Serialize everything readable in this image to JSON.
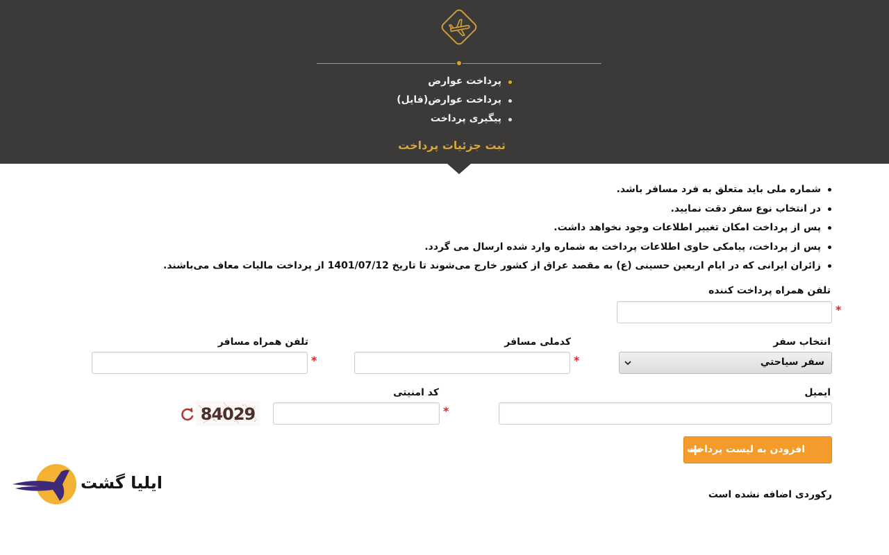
{
  "header": {
    "logo_icon": "airplane-icon",
    "menu": [
      {
        "label": "پرداخت عوارض",
        "active": true
      },
      {
        "label": "پرداخت عوارض(فایل)",
        "active": false
      },
      {
        "label": "پیگیری پرداخت",
        "active": false
      }
    ],
    "subtitle": "ثبت جزئیات پرداخت"
  },
  "notes": [
    "شماره ملی باید متعلق به فرد مسافر باشد.",
    "در انتخاب نوع سفر دقت نمایید.",
    "پس از پرداخت امکان تغییر اطلاعات وجود نخواهد داشت.",
    "پس از پرداخت، پیامکی حاوی اطلاعات پرداخت به شماره وارد شده ارسال می گردد.",
    "زائران ایرانی که در ایام اربعین حسینی (ع) به مقصد عراق از کشور خارج می‌شوند تا تاریخ 1401/07/12 از پرداخت مالیات معاف می‌باشند."
  ],
  "form": {
    "payer_phone": {
      "label": "تلفن همراه پرداخت کننده",
      "value": ""
    },
    "travel_type": {
      "label": "انتخاب سفر",
      "selected": "سفر سياحتي"
    },
    "national_code": {
      "label": "کدملی مسافر",
      "value": ""
    },
    "passenger_phone": {
      "label": "تلفن همراه مسافر",
      "value": ""
    },
    "email": {
      "label": "ایمیل",
      "value": ""
    },
    "captcha": {
      "label": "کد امنیتی",
      "value": "",
      "image_text": "84029"
    },
    "required_mark": "*",
    "add_button": "افزودن به لیست پرداخت"
  },
  "empty_message": "رکوردی اضافه نشده است",
  "brand": {
    "name": "ایلیا گشت"
  },
  "colors": {
    "header_bg": "#3b3a39",
    "gold": "#d7a53c",
    "accent": "#f39b2b",
    "required": "#d9262b"
  }
}
